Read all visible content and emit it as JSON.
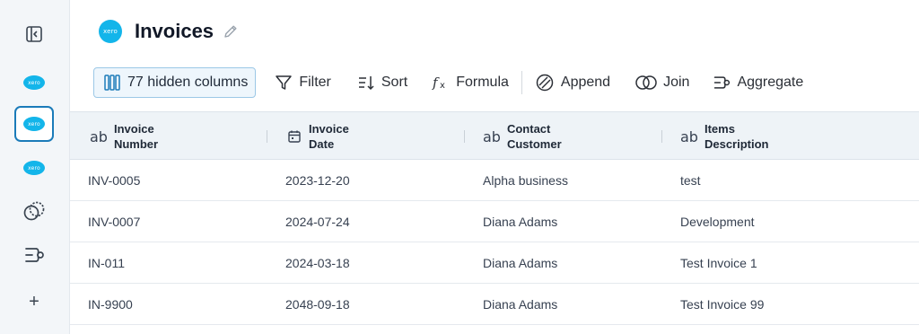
{
  "sidebar": {
    "toggle_icon": "sidebar-toggle-icon",
    "items": [
      {
        "label": "xero",
        "icon": "xero-logo-icon"
      },
      {
        "label": "xero",
        "icon": "xero-logo-icon"
      },
      {
        "label": "xero",
        "icon": "xero-logo-icon"
      },
      {
        "icon": "join-icon"
      },
      {
        "icon": "aggregate-icon"
      },
      {
        "label": "+",
        "icon": "plus-icon"
      }
    ]
  },
  "header": {
    "logo_text": "xero",
    "title": "Invoices"
  },
  "toolbar": {
    "hidden_columns": "77 hidden columns",
    "filter": "Filter",
    "sort": "Sort",
    "formula": "Formula",
    "append": "Append",
    "join": "Join",
    "aggregate": "Aggregate"
  },
  "table": {
    "columns": [
      {
        "type": "ab",
        "line1": "Invoice",
        "line2": "Number"
      },
      {
        "type": "date",
        "line1": "Invoice",
        "line2": "Date"
      },
      {
        "type": "ab",
        "line1": "Contact",
        "line2": "Customer"
      },
      {
        "type": "ab",
        "line1": "Items",
        "line2": "Description"
      }
    ],
    "rows": [
      [
        "INV-0005",
        "2023-12-20",
        "Alpha business",
        "test"
      ],
      [
        "INV-0007",
        "2024-07-24",
        "Diana Adams",
        "Development"
      ],
      [
        "IN-011",
        "2024-03-18",
        "Diana Adams",
        "Test Invoice 1"
      ],
      [
        "IN-9900",
        "2048-09-18",
        "Diana Adams",
        "Test Invoice 99"
      ]
    ]
  },
  "colors": {
    "accent": "#1b7bb9",
    "xero": "#13b5ea",
    "header_bg": "#eef3f7"
  }
}
